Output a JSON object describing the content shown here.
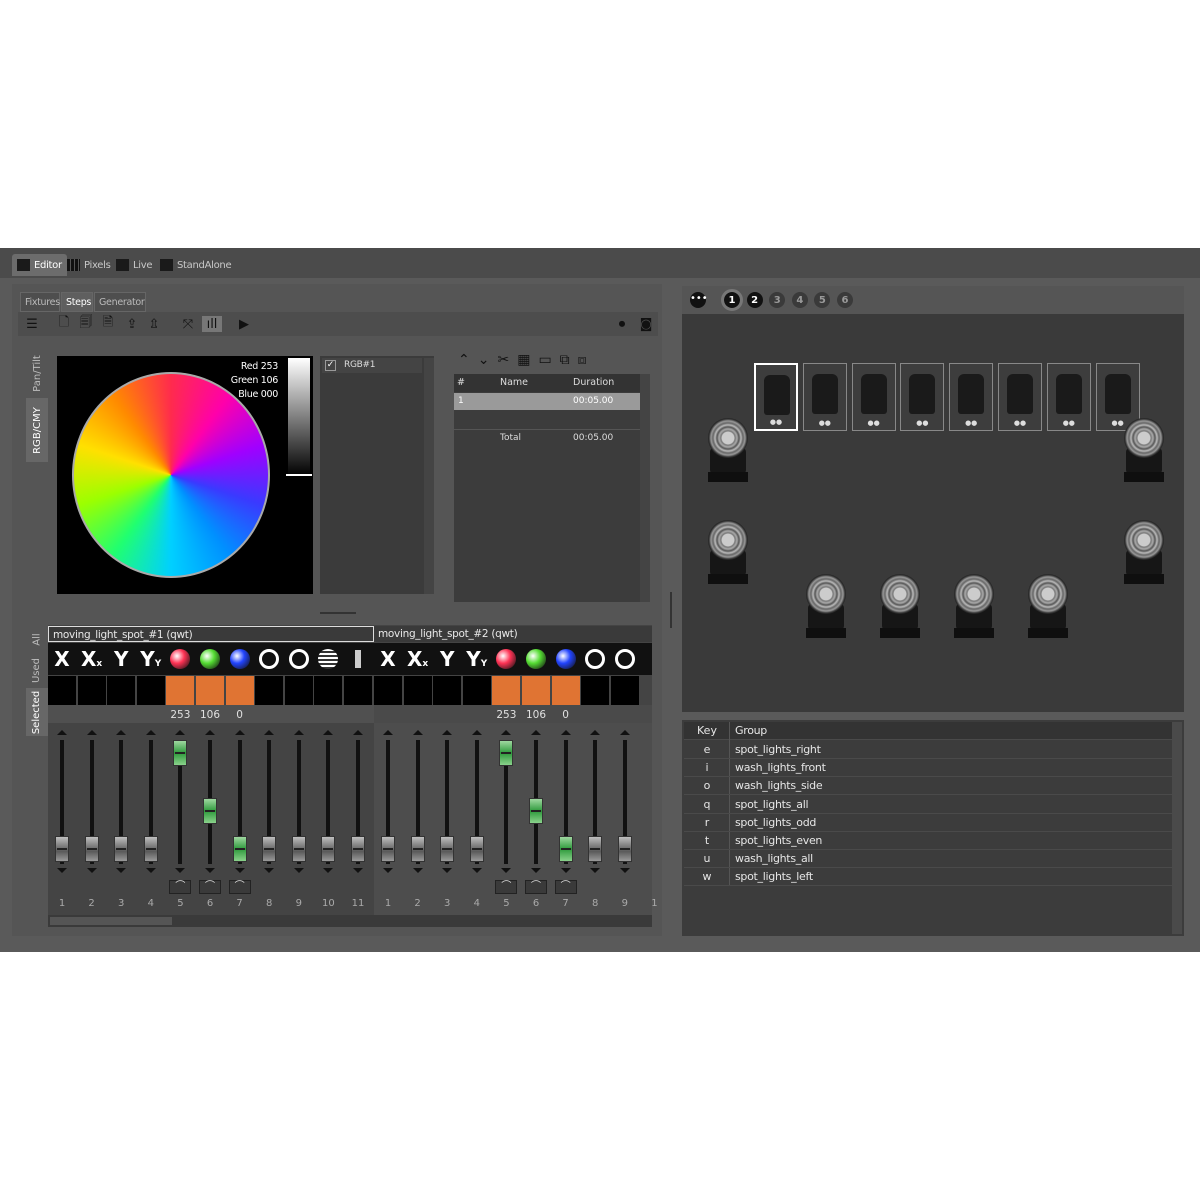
{
  "main_tabs": [
    "Editor",
    "Pixels",
    "Live",
    "StandAlone"
  ],
  "sub_tabs": [
    "Fixtures",
    "Steps",
    "Generator"
  ],
  "side_tabs_top": [
    "Pan/Tilt",
    "RGB/CMY"
  ],
  "side_tabs_bottom": [
    "All",
    "Used",
    "Selected"
  ],
  "color": {
    "red": "Red 253",
    "green": "Green 106",
    "blue": "Blue 000"
  },
  "preset": {
    "label": "RGB#1",
    "checked": true
  },
  "steps": {
    "headers": [
      "#",
      "Name",
      "Duration"
    ],
    "rows": [
      {
        "num": "1",
        "name": "",
        "duration": "00:05.00"
      }
    ],
    "total_label": "Total",
    "total_value": "00:05.00"
  },
  "channel_groups": [
    "moving_light_spot_#1 (qwt)",
    "moving_light_spot_#2 (qwt)"
  ],
  "channel_values": [
    "253",
    "106",
    "0"
  ],
  "channel_numbers_1": [
    "1",
    "2",
    "3",
    "4",
    "5",
    "6",
    "7",
    "8",
    "9",
    "10",
    "11"
  ],
  "channel_numbers_2": [
    "1",
    "2",
    "3",
    "4",
    "5",
    "6",
    "7",
    "8",
    "9",
    "1"
  ],
  "scene_buttons": [
    "1",
    "2",
    "3",
    "4",
    "5",
    "6"
  ],
  "groups": {
    "headers": [
      "Key",
      "Group"
    ],
    "rows": [
      {
        "key": "e",
        "group": "spot_lights_right"
      },
      {
        "key": "i",
        "group": "wash_lights_front"
      },
      {
        "key": "o",
        "group": "wash_lights_side"
      },
      {
        "key": "q",
        "group": "spot_lights_all"
      },
      {
        "key": "r",
        "group": "spot_lights_odd"
      },
      {
        "key": "t",
        "group": "spot_lights_even"
      },
      {
        "key": "u",
        "group": "wash_lights_all"
      },
      {
        "key": "w",
        "group": "spot_lights_left"
      }
    ]
  },
  "colors": {
    "accent": "#e07433",
    "panel": "#5a5a5a",
    "stage": "#3a3a3a"
  }
}
